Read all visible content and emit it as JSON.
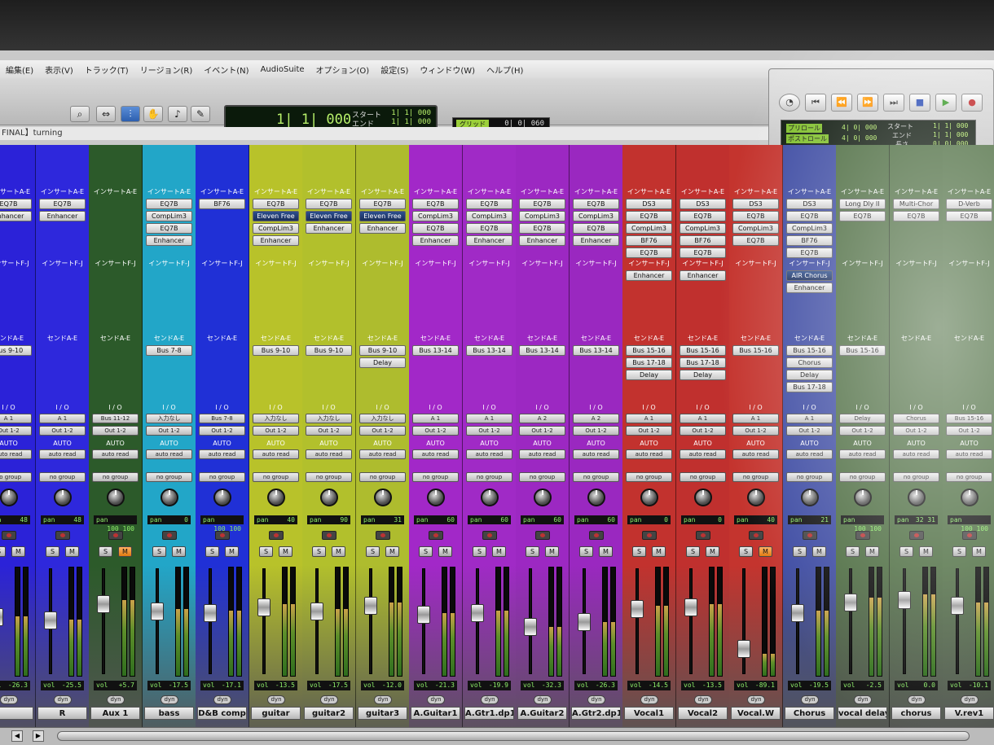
{
  "menubar": [
    "編集(E)",
    "表示(V)",
    "トラック(T)",
    "リージョン(R)",
    "イベント(N)",
    "AudioSuite",
    "オプション(O)",
    "設定(S)",
    "ウィンドウ(W)",
    "ヘルプ(H)"
  ],
  "toolbar": {
    "tools": [
      {
        "icon": "zoom-icon",
        "glyph": "⌕"
      },
      {
        "icon": "trim-icon",
        "glyph": "⇔"
      },
      {
        "icon": "selector-icon",
        "glyph": "⫶"
      },
      {
        "icon": "grabber-icon",
        "glyph": "✋"
      },
      {
        "icon": "speaker-icon",
        "glyph": "♪"
      },
      {
        "icon": "pencil-icon",
        "glyph": "✎"
      }
    ],
    "counter_main": "1| 1| 000",
    "start_label": "スタート",
    "end_label": "エンド",
    "start_value": "1| 1| 000",
    "end_value": "1| 1| 000",
    "grid_tag": "グリッド",
    "grid_value": "0| 0| 060"
  },
  "session_title": "FINAL】turning",
  "transport": {
    "preroll_label": "プリロール",
    "postroll_label": "ポストロール",
    "preroll_value": "4| 0| 000",
    "postroll_value": "4| 0| 000",
    "start_label": "スタート",
    "end_label": "エンド",
    "length_label": "長さ",
    "start_value": "1| 1| 000",
    "end_value": "1| 1| 000",
    "length_value": "0| 0| 000"
  },
  "labels": {
    "insert_ae": "インサートA-E",
    "insert_fj": "インサートF-J",
    "send_ae": "センドA-E",
    "io": "I / O",
    "auto": "AUTO",
    "auto_mode": "auto read",
    "group": "no group",
    "pan": "pan",
    "vol": "vol",
    "dyn": "dyn",
    "solo": "S",
    "mute": "M"
  },
  "tracks": [
    {
      "name": "",
      "color": "#2b22d8",
      "inserts": [
        "EQ7B",
        "Enhancer"
      ],
      "inserts_fj": [],
      "sends": [
        "Bus 9-10"
      ],
      "io_in": "A 1",
      "io_out": "Out 1-2",
      "pan": "48",
      "vol": "-26.3",
      "muted": false,
      "level": 0.55
    },
    {
      "name": "R",
      "color": "#2e28dc",
      "inserts": [
        "EQ7B",
        "Enhancer"
      ],
      "inserts_fj": [],
      "sends": [],
      "io_in": "A 1",
      "io_out": "Out 1-2",
      "pan": "48",
      "vol": "-25.5",
      "muted": false,
      "level": 0.52
    },
    {
      "name": "Aux 1",
      "color": "#2c5a2a",
      "inserts": [],
      "inserts_fj": [],
      "sends": [],
      "io_in": "Bus 11-12",
      "io_out": "Out 1-2",
      "pan": "100  100",
      "vol": "+5.7",
      "muted": true,
      "level": 0.7
    },
    {
      "name": "bass",
      "color": "#22a6c8",
      "inserts": [
        "EQ7B",
        "CompLim3",
        "EQ7B",
        "Enhancer"
      ],
      "inserts_fj": [],
      "sends": [
        "Bus 7-8"
      ],
      "io_in": "入力なし",
      "io_out": "Out 1-2",
      "pan": "0",
      "vol": "-17.5",
      "muted": false,
      "level": 0.62
    },
    {
      "name": "D&B comp",
      "color": "#2030d6",
      "inserts": [
        "BF76"
      ],
      "inserts_fj": [],
      "sends": [],
      "io_in": "Bus 7-8",
      "io_out": "Out 1-2",
      "pan": "100  100",
      "vol": "-17.1",
      "muted": false,
      "level": 0.6
    },
    {
      "name": "guitar",
      "color": "#b8c22a",
      "inserts": [
        "EQ7B",
        "Eleven Free",
        "CompLim3",
        "Enhancer"
      ],
      "inserts_fj": [],
      "sends": [
        "Bus 9-10"
      ],
      "io_in": "入力なし",
      "io_out": "Out 1-2",
      "pan": "40",
      "vol": "-13.5",
      "muted": false,
      "level": 0.66
    },
    {
      "name": "guitar2",
      "color": "#b2c02c",
      "inserts": [
        "EQ7B",
        "Eleven Free",
        "Enhancer"
      ],
      "inserts_fj": [],
      "sends": [
        "Bus 9-10"
      ],
      "io_in": "入力なし",
      "io_out": "Out 1-2",
      "pan": "90",
      "vol": "-17.5",
      "muted": false,
      "level": 0.62
    },
    {
      "name": "guitar3",
      "color": "#aebc2e",
      "inserts": [
        "EQ7B",
        "Eleven Free",
        "Enhancer"
      ],
      "inserts_fj": [],
      "sends": [
        "Bus 9-10",
        "Delay"
      ],
      "io_in": "入力なし",
      "io_out": "Out 1-2",
      "pan": "31",
      "vol": "-12.0",
      "muted": false,
      "level": 0.68
    },
    {
      "name": "A.Guitar1",
      "color": "#a228c8",
      "inserts": [
        "EQ7B",
        "CompLim3",
        "EQ7B",
        "Enhancer"
      ],
      "inserts_fj": [],
      "sends": [
        "Bus 13-14"
      ],
      "io_in": "A 1",
      "io_out": "Out 1-2",
      "pan": "60",
      "vol": "-21.3",
      "muted": false,
      "level": 0.58
    },
    {
      "name": "A.Gtr1.dp1",
      "color": "#a02ac6",
      "inserts": [
        "EQ7B",
        "CompLim3",
        "EQ7B",
        "Enhancer"
      ],
      "inserts_fj": [],
      "sends": [
        "Bus 13-14"
      ],
      "io_in": "A 1",
      "io_out": "Out 1-2",
      "pan": "60",
      "vol": "-19.9",
      "muted": false,
      "level": 0.6
    },
    {
      "name": "A.Guitar2",
      "color": "#9c28c2",
      "inserts": [
        "EQ7B",
        "CompLim3",
        "EQ7B",
        "Enhancer"
      ],
      "inserts_fj": [],
      "sends": [
        "Bus 13-14"
      ],
      "io_in": "A 2",
      "io_out": "Out 1-2",
      "pan": "60",
      "vol": "-32.3",
      "muted": false,
      "level": 0.45
    },
    {
      "name": "A.Gtr2.dp1",
      "color": "#9a28c0",
      "inserts": [
        "EQ7B",
        "CompLim3",
        "EQ7B",
        "Enhancer"
      ],
      "inserts_fj": [],
      "sends": [
        "Bus 13-14"
      ],
      "io_in": "A 2",
      "io_out": "Out 1-2",
      "pan": "60",
      "vol": "-26.3",
      "muted": false,
      "level": 0.5
    },
    {
      "name": "Vocal1",
      "color": "#c2322e",
      "inserts": [
        "DS3",
        "EQ7B",
        "CompLim3",
        "BF76",
        "EQ7B"
      ],
      "inserts_fj": [
        "Enhancer"
      ],
      "sends": [
        "Bus 15-16",
        "Bus 17-18",
        "Delay"
      ],
      "io_in": "A 1",
      "io_out": "Out 1-2",
      "pan": "0",
      "vol": "-14.5",
      "muted": false,
      "level": 0.65
    },
    {
      "name": "Vocal2",
      "color": "#c0302e",
      "inserts": [
        "DS3",
        "EQ7B",
        "CompLim3",
        "BF76",
        "EQ7B"
      ],
      "inserts_fj": [
        "Enhancer"
      ],
      "sends": [
        "Bus 15-16",
        "Bus 17-18",
        "Delay"
      ],
      "io_in": "A 1",
      "io_out": "Out 1-2",
      "pan": "0",
      "vol": "-13.5",
      "muted": false,
      "level": 0.66
    },
    {
      "name": "Vocal.W",
      "color": "#c4342e",
      "inserts": [
        "DS3",
        "EQ7B",
        "CompLim3",
        "EQ7B"
      ],
      "inserts_fj": [],
      "sends": [
        "Bus 15-16"
      ],
      "io_in": "A 1",
      "io_out": "Out 1-2",
      "pan": "40",
      "vol": "-89.1",
      "muted": true,
      "level": 0.2
    },
    {
      "name": "Chorus",
      "color": "#3c4aa2",
      "inserts": [
        "DS3",
        "EQ7B",
        "CompLim3",
        "BF76",
        "EQ7B"
      ],
      "inserts_fj": [
        "AIR Chorus",
        "Enhancer"
      ],
      "sends": [
        "Bus 15-16",
        "Chorus",
        "Delay",
        "Bus 17-18"
      ],
      "io_in": "A 1",
      "io_out": "Out 1-2",
      "pan": "21",
      "vol": "-19.5",
      "muted": false,
      "level": 0.6
    },
    {
      "name": "vocal delay",
      "color": "#4a6a3e",
      "inserts": [
        "Long Dly II",
        "EQ7B"
      ],
      "inserts_fj": [],
      "sends": [
        "Bus 15-16"
      ],
      "io_in": "Delay",
      "io_out": "Out 1-2",
      "pan": "100  100",
      "vol": "-2.5",
      "muted": false,
      "level": 0.72
    },
    {
      "name": "chorus",
      "color": "#4c6c40",
      "inserts": [
        "Multi-Chor",
        "EQ7B"
      ],
      "inserts_fj": [],
      "sends": [],
      "io_in": "Chorus",
      "io_out": "Out 1-2",
      "pan": "32  31",
      "vol": "0.0",
      "muted": false,
      "level": 0.75
    },
    {
      "name": "V.rev1",
      "color": "#4e6e42",
      "inserts": [
        "D-Verb",
        "EQ7B"
      ],
      "inserts_fj": [],
      "sends": [],
      "io_in": "Bus 15-16",
      "io_out": "Out 1-2",
      "pan": "100  100",
      "vol": "-10.1",
      "muted": false,
      "level": 0.68
    }
  ]
}
